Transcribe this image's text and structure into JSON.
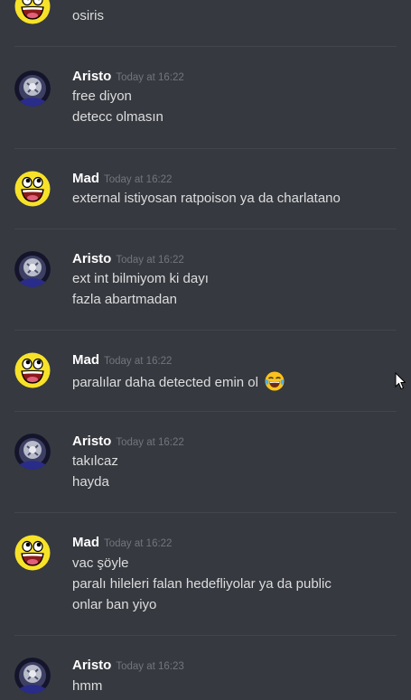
{
  "messages": [
    {
      "author": "",
      "timestamp": "",
      "avatar": "awesome-face",
      "lines": [
        "osiris"
      ]
    },
    {
      "author": "Aristo",
      "timestamp": "Today at 16:22",
      "avatar": "aristo",
      "lines": [
        "free diyon",
        "detecc olmasın"
      ]
    },
    {
      "author": "Mad",
      "timestamp": "Today at 16:22",
      "avatar": "awesome-face",
      "lines": [
        "external istiyosan ratpoison ya da charlatano"
      ]
    },
    {
      "author": "Aristo",
      "timestamp": "Today at 16:22",
      "avatar": "aristo",
      "lines": [
        "ext int bilmiyom ki dayı",
        "fazla abartmadan"
      ]
    },
    {
      "author": "Mad",
      "timestamp": "Today at 16:22",
      "avatar": "awesome-face",
      "lines": [
        "paralılar daha detected emin ol"
      ],
      "emoji": "joy-emoji"
    },
    {
      "author": "Aristo",
      "timestamp": "Today at 16:22",
      "avatar": "aristo",
      "lines": [
        "takılcaz",
        "hayda"
      ]
    },
    {
      "author": "Mad",
      "timestamp": "Today at 16:22",
      "avatar": "awesome-face",
      "lines": [
        "vac şöyle",
        "paralı hileleri falan hedefliyolar ya da public",
        "onlar ban yiyo"
      ]
    },
    {
      "author": "Aristo",
      "timestamp": "Today at 16:23",
      "avatar": "aristo",
      "lines": [
        "hmm"
      ]
    }
  ],
  "colors": {
    "background": "#36393f",
    "author": "#ffffff",
    "timestamp": "#72767d",
    "text": "#dcddde",
    "divider": "#42454a"
  },
  "icons": [
    "awesome-face-avatar",
    "aristo-avatar",
    "joy-emoji-icon",
    "mouse-cursor-icon"
  ]
}
